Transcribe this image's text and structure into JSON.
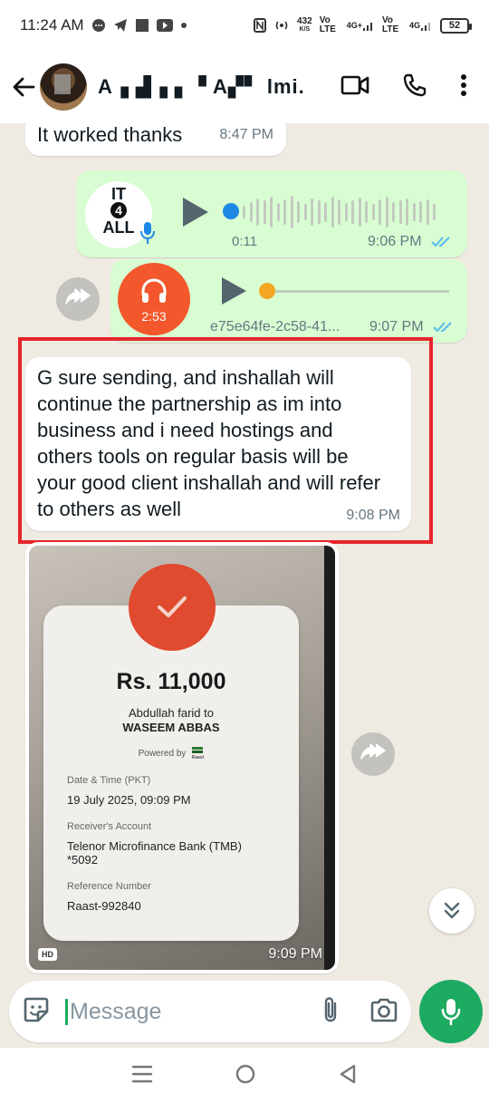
{
  "status_bar": {
    "time": "11:24 AM",
    "net_speed": "432",
    "net_speed_unit": "K/S",
    "volte1": "Vo LTE",
    "sig1": "4G+",
    "volte2": "Vo LTE",
    "sig2": "4G",
    "battery": "52"
  },
  "header": {
    "contact_name": "A▗ ▟▗ ▖▝ A▞▘ lmi..."
  },
  "messages": {
    "m1": {
      "text": "It worked thanks",
      "time": "8:47 PM"
    },
    "m2": {
      "logo_line1": "IT",
      "logo_line2": "4",
      "logo_line3": "ALL",
      "duration": "0:11",
      "time": "9:06 PM"
    },
    "m3": {
      "duration": "2:53",
      "filename": "e75e64fe-2c58-41...",
      "time": "9:07 PM"
    },
    "m4": {
      "text": "G sure sending, and inshallah will continue the partnership as im into business and i need hostings and others tools on regular basis will be your good client inshallah and will refer to others as well",
      "time": "9:08 PM"
    },
    "m5": {
      "amount": "Rs. 11,000",
      "payer_line1": "Abdullah farid to",
      "payer_line2": "WASEEM ABBAS",
      "powered_by": "Powered by",
      "raast": "Raast",
      "label_datetime": "Date & Time (PKT)",
      "value_datetime": "19 July 2025, 09:09 PM",
      "label_receiver": "Receiver's Account",
      "value_receiver_1": "Telenor Microfinance Bank (TMB)",
      "value_receiver_2": "*5092",
      "label_reference": "Reference Number",
      "value_reference": "Raast-992840",
      "hd": "HD",
      "time": "9:09 PM"
    }
  },
  "composer": {
    "placeholder": "Message"
  },
  "colors": {
    "accent_green": "#1daa61",
    "outgoing_bubble": "#d9fdd3",
    "highlight_red": "#e6252a",
    "tick_blue": "#53bdeb"
  }
}
